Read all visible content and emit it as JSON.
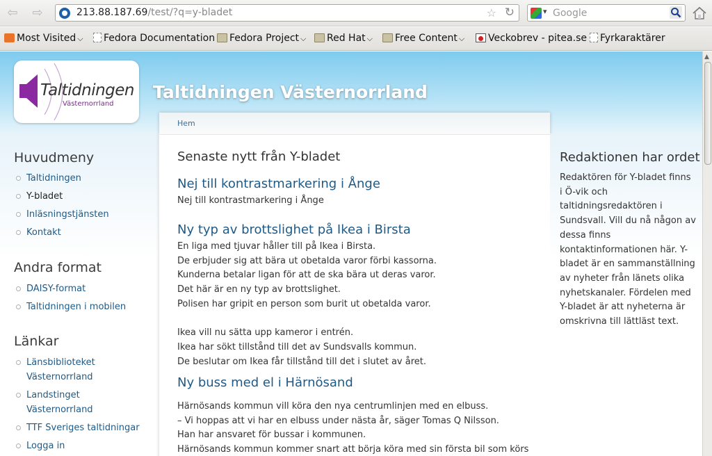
{
  "browser": {
    "url_host": "213.88.187.69",
    "url_path": "/test/?q=y-bladet",
    "search_placeholder": "Google",
    "bookmarks": [
      {
        "label": "Most Visited",
        "icon": "most-visited-icon",
        "dropdown": true
      },
      {
        "label": "Fedora Documentation",
        "icon": "page-icon",
        "dropdown": false
      },
      {
        "label": "Fedora Project",
        "icon": "folder-icon",
        "dropdown": true
      },
      {
        "label": "Red Hat",
        "icon": "folder-icon",
        "dropdown": true
      },
      {
        "label": "Free Content",
        "icon": "folder-icon",
        "dropdown": true
      },
      {
        "label": "Veckobrev - pitea.se",
        "icon": "site-icon",
        "dropdown": false
      },
      {
        "label": "Fyrkaraktärer",
        "icon": "page-icon",
        "dropdown": false
      }
    ]
  },
  "site": {
    "logo_name": "Taltidningen",
    "logo_sub": "Västernorrland",
    "name": "Taltidningen Västernorrland",
    "colors": {
      "header": "#7fcbee",
      "link": "#1e5a87"
    }
  },
  "breadcrumb": "Hem",
  "sidebar_left": {
    "blocks": [
      {
        "title": "Huvudmeny",
        "items": [
          "Taltidningen",
          "Y-bladet",
          "Inläsningstjänsten",
          "Kontakt"
        ],
        "active": 1
      },
      {
        "title": "Andra format",
        "items": [
          "DAISY-format",
          "Taltidningen i mobilen"
        ]
      },
      {
        "title": "Länkar",
        "items": [
          "Länsbiblioteket Västernorrland",
          "Landstinget Västernorrland",
          "TTF Sveriges taltidningar",
          "Logga in"
        ]
      }
    ]
  },
  "main": {
    "title": "Senaste nytt från Y-bladet",
    "articles": [
      {
        "title": "Nej till kontrastmarkering i Ånge",
        "lines": [
          "Nej till kontrastmarkering i Ånge"
        ]
      },
      {
        "title": "Ny typ av brottslighet på Ikea i Birsta",
        "lines": [
          "En liga med tjuvar håller till på Ikea i Birsta.",
          "De erbjuder sig att bära ut obetalda varor förbi kassorna.",
          "Kunderna betalar ligan för att de ska bära ut deras varor.",
          "Det här är en ny typ av brottslighet.",
          "Polisen har gripit en person som burit ut obetalda varor.",
          "",
          "Ikea vill nu sätta upp kameror i entrén.",
          "Ikea har sökt tillstånd till det av Sundsvalls kommun.",
          "De beslutar om Ikea får tillstånd till det i slutet av året."
        ]
      },
      {
        "title": "Ny buss med el i Härnösand",
        "lines": [
          "Härnösands kommun vill köra den nya centrumlinjen med en elbuss.",
          "– Vi hoppas att vi har en elbuss under nästa år, säger Tomas Q Nilsson.",
          "Han har ansvaret för bussar i kommunen.",
          "Härnösands kommun kommer snart att börja köra med sin första bil som körs"
        ]
      }
    ]
  },
  "sidebar_right": {
    "title": "Redaktionen har ordet",
    "text": "Redaktören för Y-bladet finns i Ö-vik och taltidningsredaktören i Sundsvall. Vill du nå någon av dessa finns kontaktinformationen här. Y-bladet är en sammanställning av nyheter från länets olika nyhetskanaler. Fördelen med Y-bladet är att nyheterna är omskrivna till lättläst text."
  }
}
